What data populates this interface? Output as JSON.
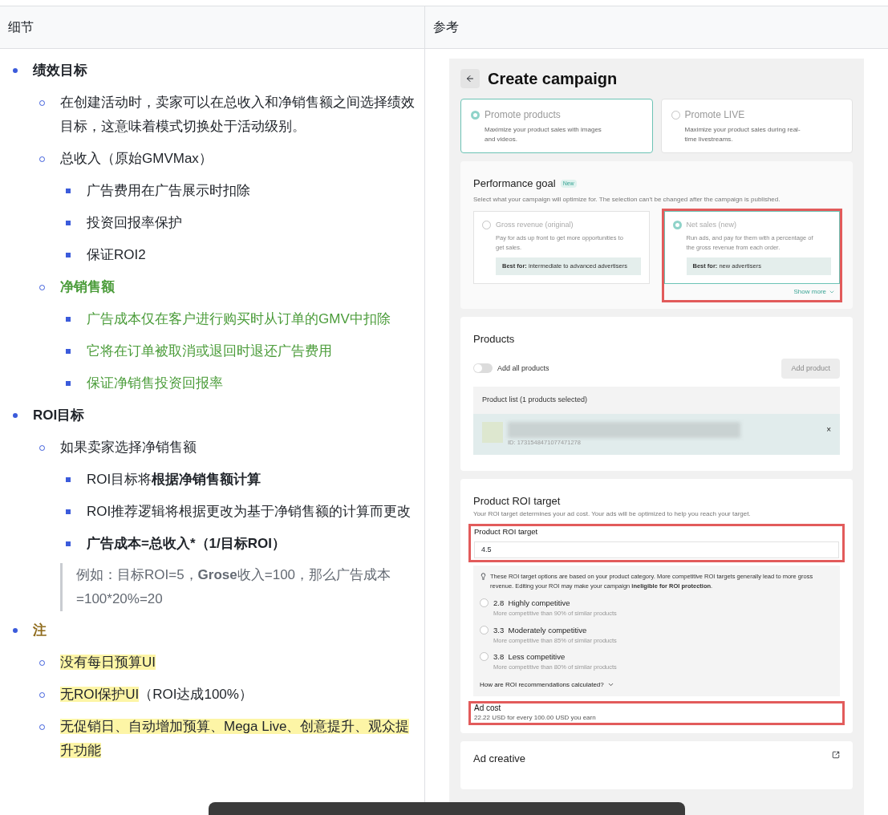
{
  "table": {
    "headers": [
      "细节",
      "参考"
    ]
  },
  "notes": [
    {
      "text": "绩效目标",
      "bold": true,
      "kind": "plain",
      "children": [
        {
          "text": "在创建活动时，卖家可以在总收入和净销售额之间选择绩效目标，这意味着模式切换处于活动级别。",
          "bold": false,
          "kind": "plain"
        },
        {
          "text": "总收入（原始GMVMax）",
          "bold": false,
          "kind": "plain",
          "children": [
            {
              "text": "广告费用在广告展示时扣除",
              "bold": false,
              "kind": "plain"
            },
            {
              "text": "投资回报率保护",
              "bold": false,
              "kind": "plain"
            },
            {
              "text": "保证ROI2",
              "bold": false,
              "kind": "plain"
            }
          ]
        },
        {
          "text": "净销售额",
          "bold": true,
          "kind": "accent",
          "children": [
            {
              "text": "广告成本仅在客户进行购买时从订单的GMV中扣除",
              "bold": false,
              "kind": "accent"
            },
            {
              "text": "它将在订单被取消或退回时退还广告费用",
              "bold": false,
              "kind": "accent"
            },
            {
              "text": "保证净销售投资回报率",
              "bold": false,
              "kind": "accent"
            }
          ]
        }
      ]
    },
    {
      "text": "ROI目标",
      "bold": true,
      "kind": "plain",
      "children": [
        {
          "text": "如果卖家选择净销售额",
          "bold": false,
          "kind": "plain",
          "children": [
            {
              "text": "ROI目标将**根据净销售额计算**",
              "bold": false,
              "kind": "plain"
            },
            {
              "text": "ROI推荐逻辑将根据更改为基于净销售额的计算而更改",
              "bold": false,
              "kind": "plain"
            },
            {
              "text": "广告成本=总收入*（1/目标ROI）",
              "bold": true,
              "kind": "plain"
            }
          ],
          "quote": "例如：目标ROI=5，**Grose**收入=100，那么广告成本=100*20%=20"
        }
      ]
    },
    {
      "text": "注",
      "bold": true,
      "kind": "note",
      "children": [
        {
          "text": "没有每日预算UI",
          "bold": false,
          "kind": "plain",
          "highlight": true
        },
        {
          "text": "无ROI保护UI",
          "rest": "（ROI达成100%）",
          "bold": false,
          "kind": "plain",
          "highlight": true
        },
        {
          "text": "无促销日、自动增加预算、Mega Live、创意提升、观众提升功能",
          "bold": false,
          "kind": "plain",
          "highlight": true
        }
      ]
    }
  ],
  "campaign": {
    "title": "Create campaign",
    "promote_options": [
      {
        "title": "Promote products",
        "desc": "Maximize your product sales with images and videos.",
        "selected": true
      },
      {
        "title": "Promote LIVE",
        "desc": "Maximize your product sales during real-time livestreams.",
        "selected": false
      }
    ],
    "performance_goal": {
      "title": "Performance goal",
      "badge": "New",
      "subtitle": "Select what your campaign will optimize for. The selection can't be changed after the campaign is published.",
      "options": [
        {
          "title": "Gross revenue (original)",
          "desc": "Pay for ads up front to get more opportunities to get sales.",
          "best_for": "**Best for:** intermediate to advanced advertisers",
          "selected": false,
          "marked": false
        },
        {
          "title": "Net sales (new)",
          "desc": "Run ads, and pay for them with a percentage of the gross revenue from each order.",
          "best_for": "**Best for:** new advertisers",
          "selected": true,
          "marked": true
        }
      ],
      "show_more": "Show more"
    },
    "products": {
      "title": "Products",
      "toggle": {
        "label": "Add all products",
        "on": false
      },
      "add_button": {
        "label": "Add product",
        "disabled": true
      },
      "list_title": "Product list (1 products selected)",
      "product": {
        "id": "ID: 1731548471077471278",
        "remove": "×"
      }
    },
    "roi_target": {
      "title": "Product ROI target",
      "subtitle": "Your ROI target determines your ad cost. Your ads will be optimized to help you reach your target.",
      "field": {
        "label": "Product ROI target",
        "value": "4.5",
        "marked": true
      },
      "info": "These ROI target options are based on your product category. More competitive ROI targets generally lead to more gross revenue. Editing your ROI may make your campaign **ineligible for ROI protection**.",
      "options": [
        {
          "value": "2.8",
          "label": "Highly competitive",
          "desc": "More competitive than 90% of similar products",
          "selected": false
        },
        {
          "value": "3.3",
          "label": "Moderately competitive",
          "desc": "More competitive than 85% of similar products",
          "selected": false
        },
        {
          "value": "3.8",
          "label": "Less competitive",
          "desc": "More competitive than 80% of similar products",
          "selected": false
        }
      ],
      "link": "How are ROI recommendations calculated?",
      "ad_cost": {
        "label": "Ad cost",
        "text": "22.22 USD for every 100.00 USD you earn",
        "marked": true
      }
    },
    "ad_creative": {
      "title": "Ad creative"
    }
  }
}
